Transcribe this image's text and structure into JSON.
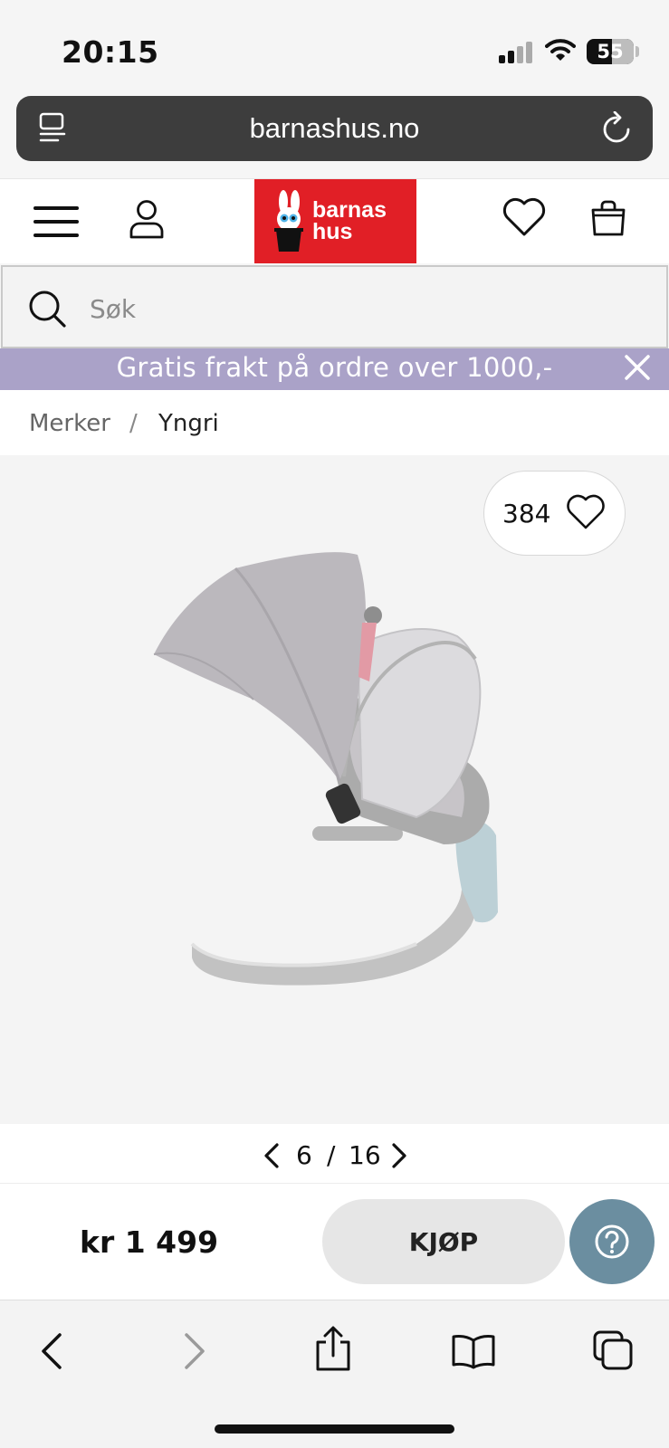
{
  "status_bar": {
    "time": "20:15",
    "battery": "55"
  },
  "browser": {
    "url": "barnashus.no"
  },
  "header": {
    "logo_line1": "barnas",
    "logo_line2": "hus",
    "brand_color": "#e11f26"
  },
  "search": {
    "placeholder": "Søk"
  },
  "promo_banner": {
    "text": "Gratis frakt på ordre over 1000,-",
    "color": "#aaa2c8"
  },
  "breadcrumb": {
    "items": [
      "Merker",
      "Yngri"
    ],
    "separator": "/"
  },
  "product": {
    "favorite_count": "384",
    "image_subject": "grey baby swing bouncer with canopy and mosquito net"
  },
  "gallery_pager": {
    "current": "6",
    "separator": "/",
    "total": "16"
  },
  "purchase": {
    "price": "kr 1 499",
    "buy_label": "KJØP"
  },
  "icons": [
    "menu-icon",
    "reload-icon",
    "hamburger-icon",
    "account-icon",
    "wishlist-icon",
    "bag-icon",
    "search-icon",
    "close-icon",
    "heart-icon",
    "chevron-left-icon",
    "chevron-right-icon",
    "help-icon",
    "back-icon",
    "forward-icon",
    "share-icon",
    "bookmarks-icon",
    "tabs-icon"
  ]
}
